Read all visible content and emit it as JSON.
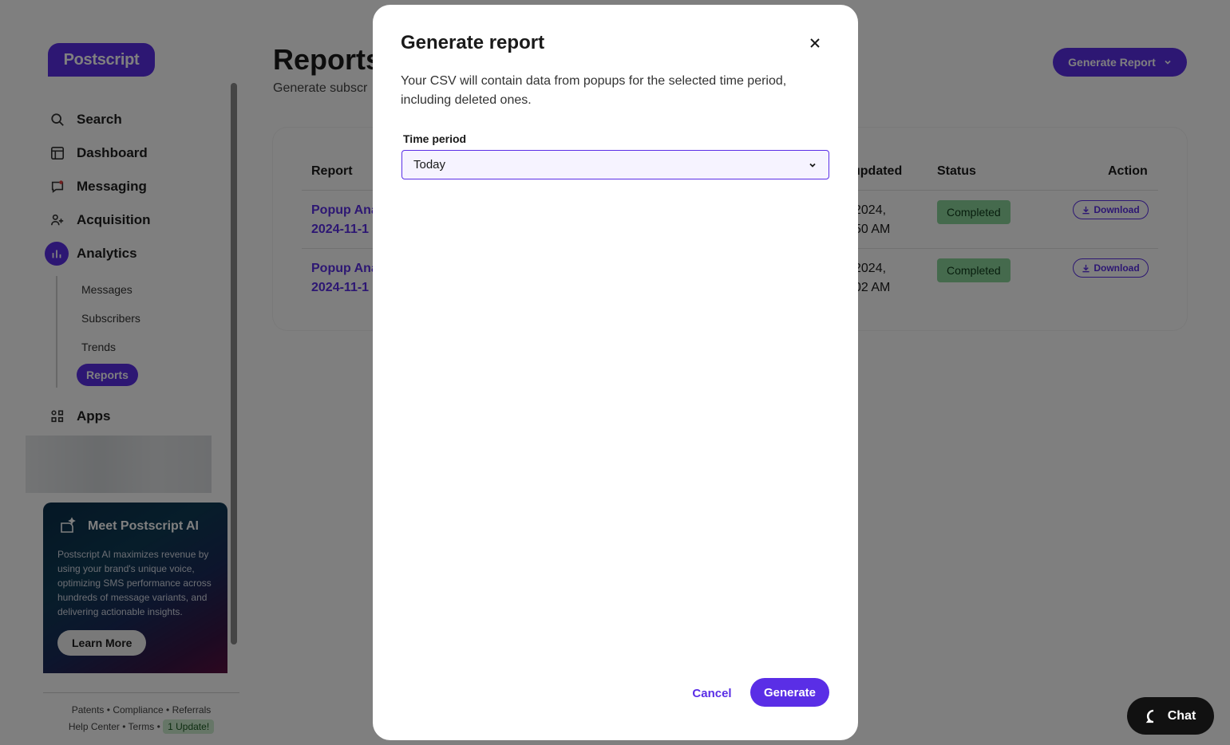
{
  "brand": {
    "logo_text": "Postscript",
    "accent": "#5a2ee6"
  },
  "sidebar": {
    "items": [
      {
        "label": "Search",
        "icon": "search-icon"
      },
      {
        "label": "Dashboard",
        "icon": "dashboard-icon"
      },
      {
        "label": "Messaging",
        "icon": "messaging-icon"
      },
      {
        "label": "Acquisition",
        "icon": "acquisition-icon"
      },
      {
        "label": "Analytics",
        "icon": "analytics-icon"
      },
      {
        "label": "Apps",
        "icon": "apps-icon"
      }
    ],
    "analytics_sub": [
      "Messages",
      "Subscribers",
      "Trends",
      "Reports"
    ],
    "ai_card": {
      "title": "Meet Postscript AI",
      "description": "Postscript AI maximizes revenue by using your brand's unique voice, optimizing SMS performance across hundreds of message variants, and delivering actionable insights.",
      "button": "Learn More"
    },
    "footer": {
      "links_row1": [
        "Patents",
        "Compliance",
        "Referrals"
      ],
      "links_row2": [
        "Help Center",
        "Terms"
      ],
      "update_badge": "1 Update!"
    }
  },
  "main": {
    "title": "Reports",
    "subtitle": "Generate subscr",
    "generate_button": "Generate Report",
    "table": {
      "headers": {
        "report": "Report",
        "updated": "updated",
        "status": "Status",
        "action": "Action"
      },
      "rows": [
        {
          "report_line1": "Popup Ana",
          "report_line2": "2024-11-1",
          "date_line1": "2024,",
          "date_line2": "50 AM",
          "status": "Completed",
          "action": "Download"
        },
        {
          "report_line1": "Popup Ana",
          "report_line2": "2024-11-1",
          "date_line1": "2024,",
          "date_line2": "02 AM",
          "status": "Completed",
          "action": "Download"
        }
      ]
    }
  },
  "modal": {
    "title": "Generate report",
    "description": "Your CSV will contain data from popups for the selected time period, including deleted ones.",
    "field_label": "Time period",
    "select_value": "Today",
    "cancel": "Cancel",
    "generate": "Generate"
  },
  "chat": {
    "label": "Chat"
  }
}
